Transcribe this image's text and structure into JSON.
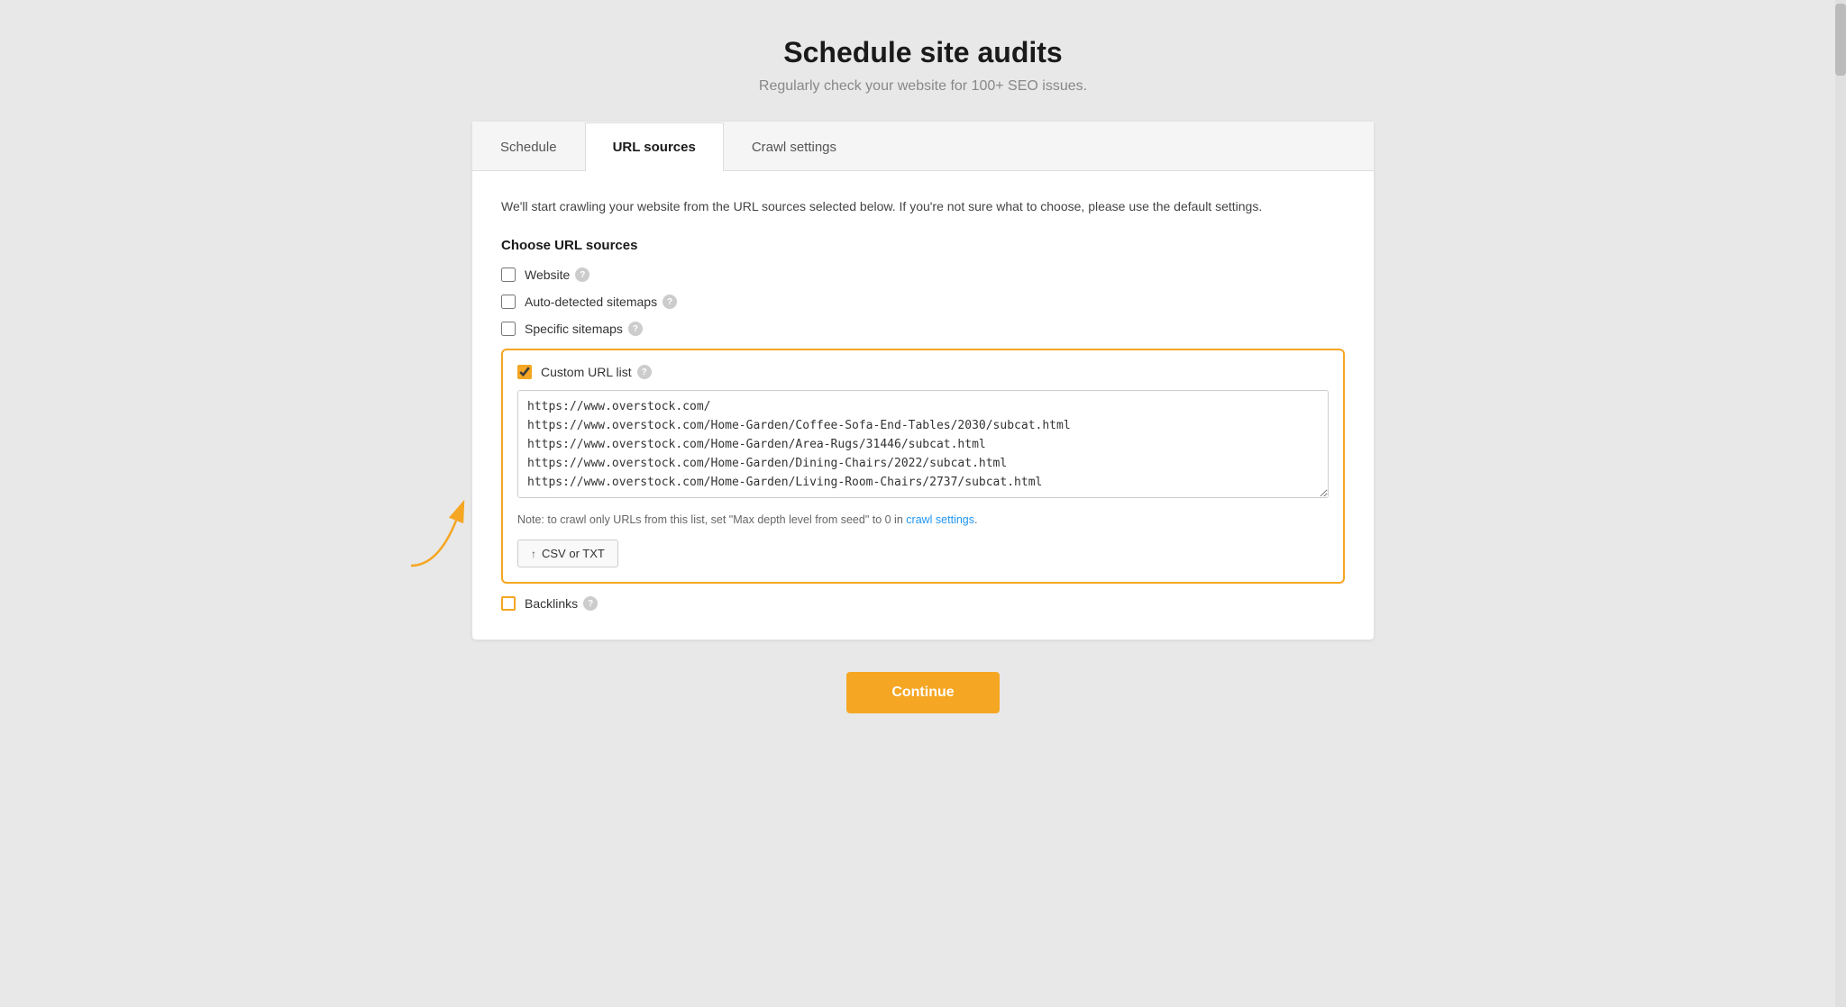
{
  "page": {
    "title": "Schedule site audits",
    "subtitle": "Regularly check your website for 100+ SEO issues."
  },
  "tabs": [
    {
      "id": "schedule",
      "label": "Schedule",
      "active": false
    },
    {
      "id": "url-sources",
      "label": "URL sources",
      "active": true
    },
    {
      "id": "crawl-settings",
      "label": "Crawl settings",
      "active": false
    }
  ],
  "content": {
    "description": "We'll start crawling your website from the URL sources selected below. If you're not sure what to choose, please use the default settings.",
    "section_title": "Choose URL sources",
    "checkboxes": [
      {
        "id": "website",
        "label": "Website",
        "checked": false
      },
      {
        "id": "auto-sitemaps",
        "label": "Auto-detected sitemaps",
        "checked": false
      },
      {
        "id": "specific-sitemaps",
        "label": "Specific sitemaps",
        "checked": false
      }
    ],
    "custom_url": {
      "label": "Custom URL list",
      "checked": true,
      "textarea_content": "https://www.overstock.com/\nhttps://www.overstock.com/Home-Garden/Coffee-Sofa-End-Tables/2030/subcat.html\nhttps://www.overstock.com/Home-Garden/Area-Rugs/31446/subcat.html\nhttps://www.overstock.com/Home-Garden/Dining-Chairs/2022/subcat.html\nhttps://www.overstock.com/Home-Garden/Living-Room-Chairs/2737/subcat.html",
      "note": "Note: to crawl only URLs from this list, set \"Max depth level from seed\" to 0 in",
      "note_link": "crawl settings",
      "csv_btn_label": "CSV or TXT"
    },
    "backlinks": {
      "label": "Backlinks",
      "checked": false
    },
    "continue_btn": "Continue"
  }
}
